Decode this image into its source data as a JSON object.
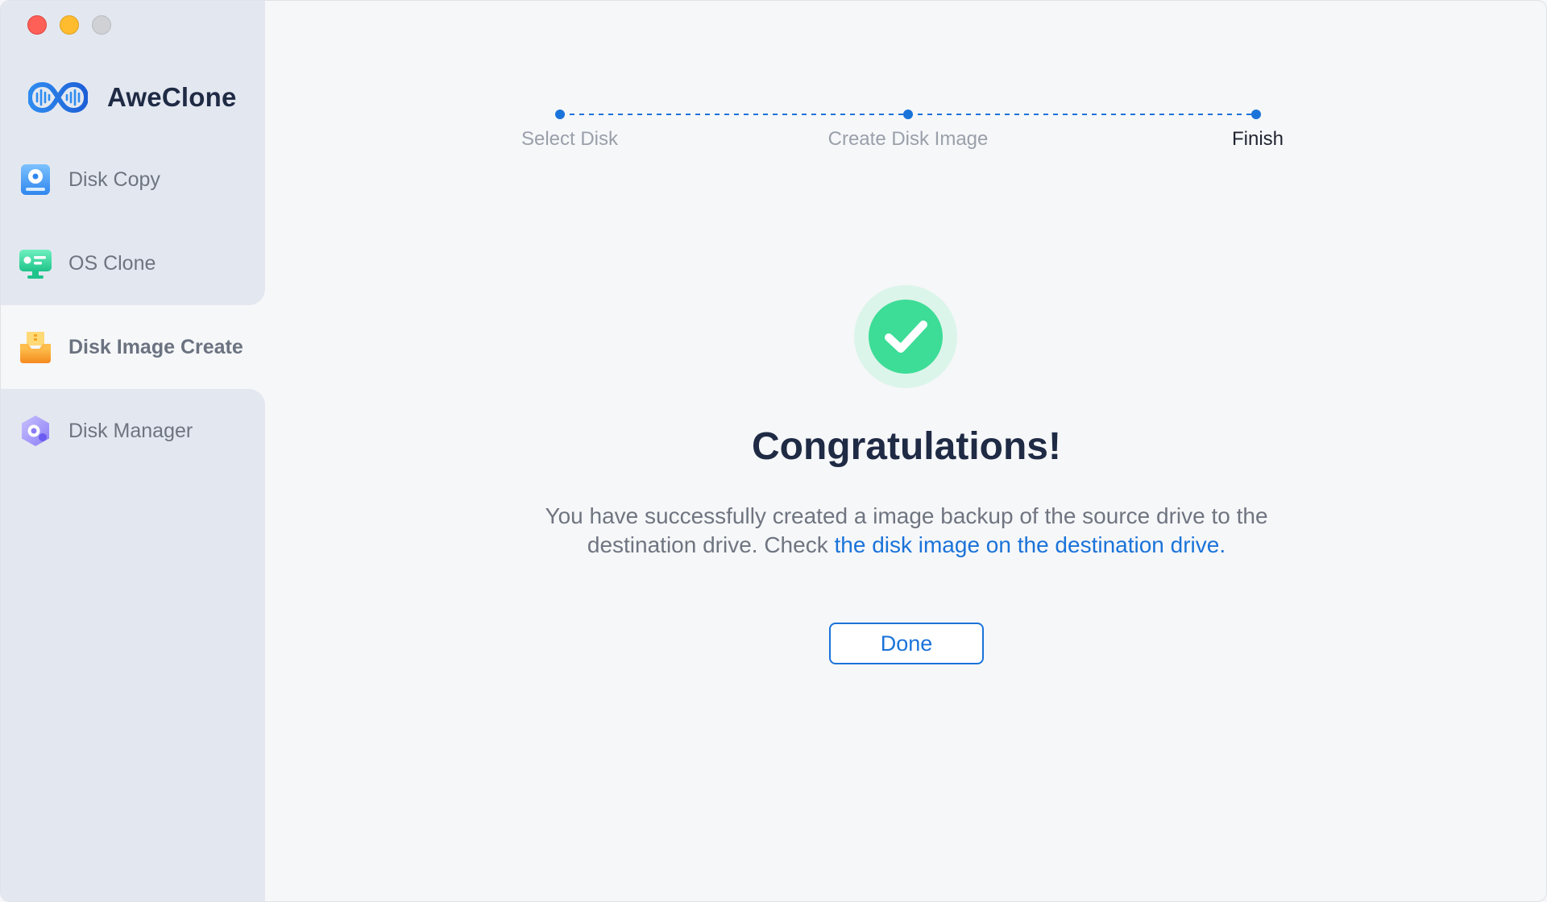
{
  "window": {
    "controls": [
      "close",
      "minimize",
      "maximize"
    ]
  },
  "brand": {
    "name": "AweClone",
    "logo_icon": "infinity-wave-logo"
  },
  "sidebar": {
    "items": [
      {
        "label": "Disk Copy",
        "icon": "disk-copy-icon",
        "active": false
      },
      {
        "label": "OS Clone",
        "icon": "os-clone-icon",
        "active": false
      },
      {
        "label": "Disk Image Create",
        "icon": "disk-image-create-icon",
        "active": true
      },
      {
        "label": "Disk Manager",
        "icon": "disk-manager-icon",
        "active": false
      }
    ]
  },
  "stepper": {
    "steps": [
      {
        "label": "Select Disk",
        "state": "done"
      },
      {
        "label": "Create Disk Image",
        "state": "done"
      },
      {
        "label": "Finish",
        "state": "current"
      }
    ]
  },
  "result": {
    "title": "Congratulations!",
    "message_prefix": "You have successfully created a image backup of the source drive to the destination drive. Check ",
    "message_link": "the disk image on the destination drive.",
    "done_label": "Done"
  },
  "colors": {
    "accent": "#1a73d9",
    "success": "#3ddc97",
    "sidebar_bg": "#e3e8f0",
    "main_bg": "#f6f7f9"
  }
}
